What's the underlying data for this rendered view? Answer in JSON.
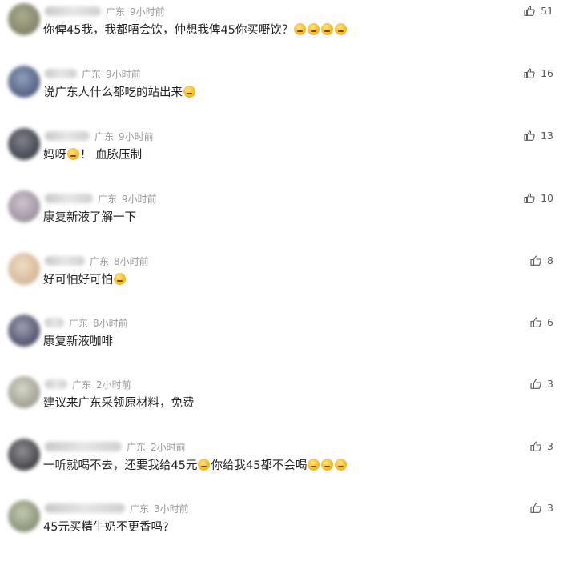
{
  "comments": [
    {
      "location": "广东",
      "time": "9小时前",
      "text": "你俾45我，我都唔会饮，仲想我俾45你买嘢饮？",
      "emojis": 4,
      "likes": "51",
      "avatar_colors": [
        "#6b6a4d",
        "#9aa07a"
      ],
      "name_width": 70
    },
    {
      "location": "广东",
      "time": "9小时前",
      "text": "说广东人什么都吃的站出来",
      "emojis": 1,
      "likes": "16",
      "avatar_colors": [
        "#2f3f6a",
        "#7f8fb0"
      ],
      "name_width": 40
    },
    {
      "location": "广东",
      "time": "9小时前",
      "text": "妈呀",
      "text_after": "！ 血脉压制",
      "emoji_mid": 1,
      "emojis": 0,
      "likes": "13",
      "avatar_colors": [
        "#1c1f2a",
        "#6b6e7a"
      ],
      "name_width": 56
    },
    {
      "location": "广东",
      "time": "9小时前",
      "text": "康复新液了解一下",
      "emojis": 0,
      "likes": "10",
      "avatar_colors": [
        "#8a7c8e",
        "#c6b9c6"
      ],
      "name_width": 60
    },
    {
      "location": "广东",
      "time": "8小时前",
      "text": "好可怕好可怕",
      "emojis": 1,
      "likes": "8",
      "avatar_colors": [
        "#caa884",
        "#efd7b8"
      ],
      "name_width": 50
    },
    {
      "location": "广东",
      "time": "8小时前",
      "text": "康复新液咖啡",
      "emojis": 0,
      "likes": "6",
      "avatar_colors": [
        "#2d3050",
        "#8d8fa6"
      ],
      "name_width": 24
    },
    {
      "location": "广东",
      "time": "2小时前",
      "text": "建议来广东采领原材料，免费",
      "emojis": 0,
      "likes": "3",
      "avatar_colors": [
        "#8b8a7a",
        "#d0d0c0"
      ],
      "name_width": 28
    },
    {
      "location": "广东",
      "time": "2小时前",
      "text": "一听就喝不去，还要我给45元",
      "emoji_mid": 1,
      "text_after": "你给我45都不会喝",
      "emojis": 3,
      "likes": "3",
      "avatar_colors": [
        "#1d1d22",
        "#7c7c84"
      ],
      "name_width": 96
    },
    {
      "location": "广东",
      "time": "3小时前",
      "text": "45元买精牛奶不更香吗?",
      "emojis": 0,
      "likes": "3",
      "avatar_colors": [
        "#6f7a5a",
        "#b9c0a5"
      ],
      "name_width": 100
    }
  ]
}
